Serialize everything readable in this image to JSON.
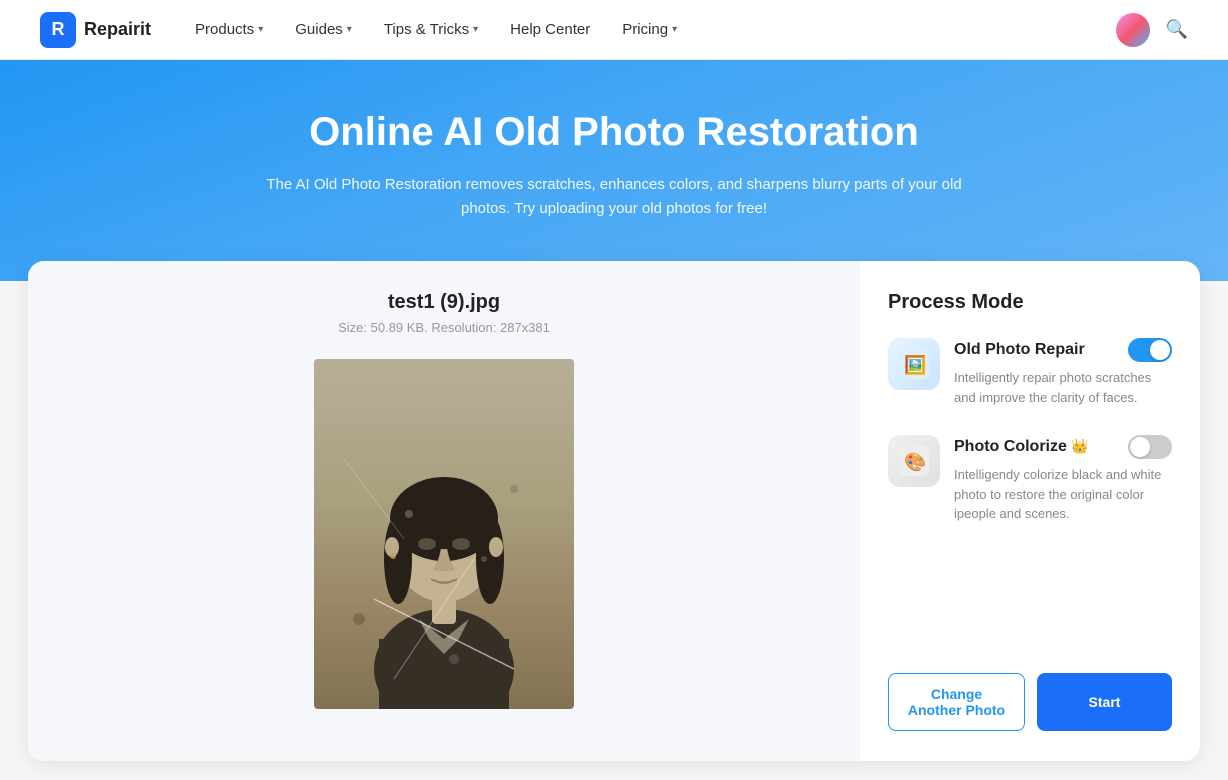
{
  "nav": {
    "logo_text": "Repairit",
    "items": [
      {
        "label": "Products",
        "has_chevron": true
      },
      {
        "label": "Guides",
        "has_chevron": true
      },
      {
        "label": "Tips & Tricks",
        "has_chevron": true
      },
      {
        "label": "Help Center",
        "has_chevron": false
      },
      {
        "label": "Pricing",
        "has_chevron": true
      }
    ]
  },
  "hero": {
    "title": "Online AI Old Photo Restoration",
    "subtitle": "The AI Old Photo Restoration removes scratches, enhances colors, and sharpens blurry parts of your old photos. Try uploading your old photos for free!"
  },
  "photo": {
    "filename": "test1 (9).jpg",
    "meta": "Size: 50.89 KB. Resolution: 287x381"
  },
  "sidebar": {
    "process_mode_title": "Process Mode",
    "modes": [
      {
        "name": "Old Photo Repair",
        "desc": "Intelligently repair photo scratches and improve the clarity of faces.",
        "enabled": true,
        "badge": ""
      },
      {
        "name": "Photo Colorize",
        "desc": "Intelligendy colorize black and white photo to restore the original color ipeople and scenes.",
        "enabled": false,
        "badge": "👑"
      }
    ],
    "btn_change": "Change Another Photo",
    "btn_start": "Start"
  }
}
